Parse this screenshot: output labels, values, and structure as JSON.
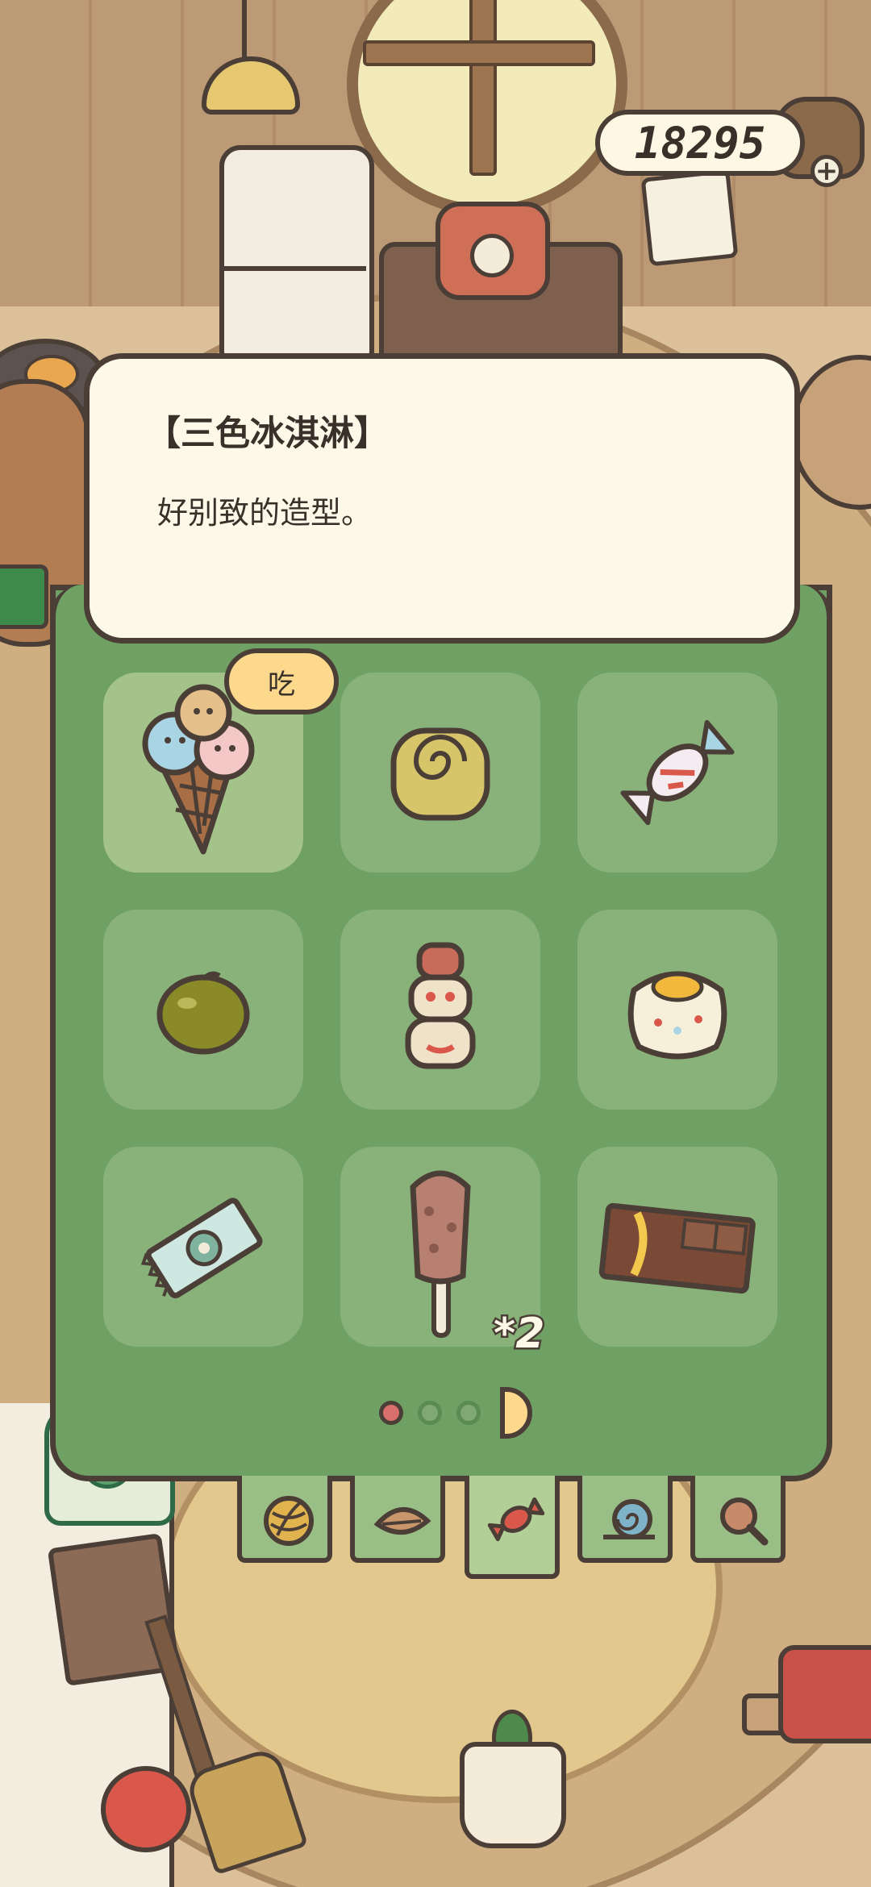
{
  "coins": {
    "value": "18295",
    "add_icon": "plus-icon"
  },
  "item_detail": {
    "title": "【三色冰淇淋】",
    "description": "好别致的造型。"
  },
  "action": {
    "eat_label": "吃"
  },
  "inventory": {
    "items": [
      {
        "name": "tricolor-ice-cream",
        "icon": "ice-cream-icon",
        "selected": true
      },
      {
        "name": "roll-cake",
        "icon": "roll-cake-icon"
      },
      {
        "name": "candy",
        "icon": "candy-icon"
      },
      {
        "name": "fruit",
        "icon": "fruit-icon"
      },
      {
        "name": "dango-stack",
        "icon": "dango-icon"
      },
      {
        "name": "bun",
        "icon": "bun-icon"
      },
      {
        "name": "wrapped-snack",
        "icon": "wrapped-snack-icon"
      },
      {
        "name": "chocolate-popsicle",
        "icon": "popsicle-icon",
        "count": "*2"
      },
      {
        "name": "chocolate-bar",
        "icon": "chocolate-bar-icon"
      }
    ]
  },
  "pagination": {
    "current_page": 1,
    "total_pages": 3
  },
  "tabs": [
    {
      "name": "yarn",
      "icon": "yarn-icon"
    },
    {
      "name": "leaf",
      "icon": "leaf-icon"
    },
    {
      "name": "snacks",
      "icon": "candy-icon",
      "active": true
    },
    {
      "name": "snail",
      "icon": "snail-icon"
    },
    {
      "name": "magnifier",
      "icon": "magnifier-icon"
    }
  ],
  "colors": {
    "panel": "#6fa064",
    "cell": "#89b27a",
    "bubble": "#fdf9e8",
    "outline": "#4a3e36",
    "button": "#fcd98d"
  }
}
